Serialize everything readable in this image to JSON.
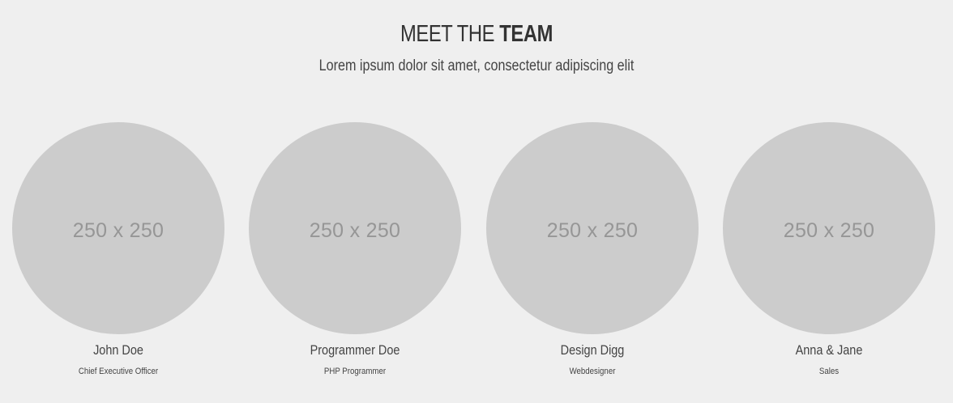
{
  "header": {
    "title_light": "MEET THE ",
    "title_bold": "TEAM",
    "subtitle": "Lorem ipsum dolor sit amet, consectetur adipiscing elit"
  },
  "members": [
    {
      "placeholder": "250 x 250",
      "name": "John Doe",
      "role": "Chief Executive Officer"
    },
    {
      "placeholder": "250 x 250",
      "name": "Programmer Doe",
      "role": "PHP Programmer"
    },
    {
      "placeholder": "250 x 250",
      "name": "Design Digg",
      "role": "Webdesigner"
    },
    {
      "placeholder": "250 x 250",
      "name": "Anna & Jane",
      "role": "Sales"
    }
  ],
  "colors": {
    "background": "#efefef",
    "avatar_placeholder": "#cccccc",
    "placeholder_text": "#969696",
    "text": "#333333"
  }
}
